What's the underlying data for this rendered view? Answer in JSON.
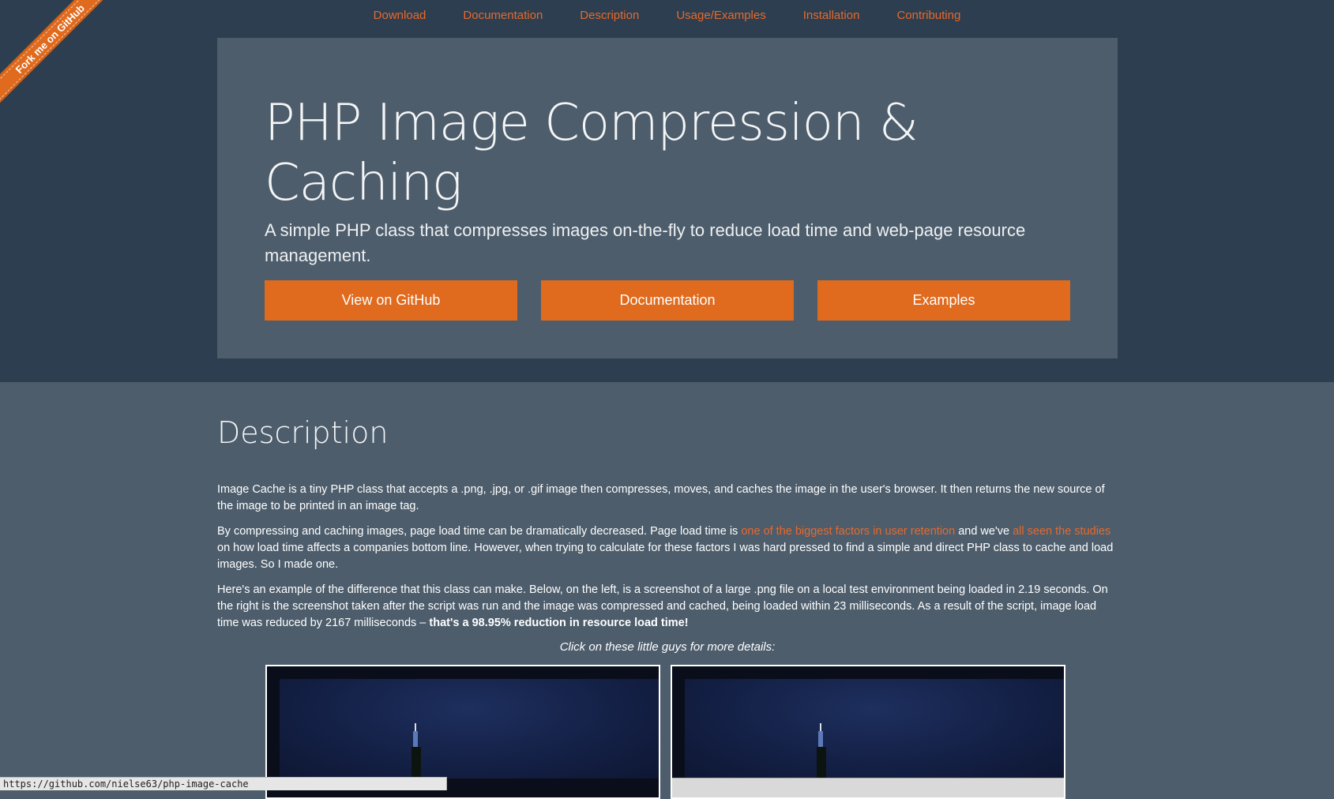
{
  "nav": {
    "items": [
      {
        "label": "Download"
      },
      {
        "label": "Documentation"
      },
      {
        "label": "Description"
      },
      {
        "label": "Usage/Examples"
      },
      {
        "label": "Installation"
      },
      {
        "label": "Contributing"
      }
    ]
  },
  "ribbon": {
    "label": "Fork me on GitHub"
  },
  "hero": {
    "title": "PHP Image Compression & Caching",
    "subtitle": "A simple PHP class that compresses images on-the-fly to reduce load time and web-page resource management.",
    "buttons": {
      "github": "View on GitHub",
      "documentation": "Documentation",
      "examples": "Examples"
    }
  },
  "description": {
    "heading": "Description",
    "p1": "Image Cache is a tiny PHP class that accepts a .png, .jpg, or .gif image then compresses, moves, and caches the image in the user's browser. It then returns the new source of the image to be printed in an image tag.",
    "p2_before_link1": "By compressing and caching images, page load time can be dramatically decreased. Page load time is ",
    "p2_link1": "one of the biggest factors in user retention",
    "p2_between": " and we've ",
    "p2_link2": "all seen the studies",
    "p2_after": " on how load time affects a companies bottom line. However, when trying to calculate for these factors I was hard pressed to find a simple and direct PHP class to cache and load images. So I made one.",
    "p3_text": "Here's an example of the difference that this class can make. Below, on the left, is a screenshot of a large .png file on a local test environment being loaded in 2.19 seconds. On the right is the screenshot taken after the script was run and the image was compressed and cached, being loaded within 23 milliseconds. As a result of the script, image load time was reduced by 2167 milliseconds – ",
    "p3_bold": "that's a 98.95% reduction in resource load time!",
    "caption": "Click on these little guys for more details:"
  },
  "status_bar": {
    "url": "https://github.com/nielse63/php-image-cache"
  },
  "colors": {
    "header_bg": "#2c3e50",
    "panel_bg": "#4d5d6c",
    "accent": "#e06a1d",
    "link": "#e8692a"
  }
}
